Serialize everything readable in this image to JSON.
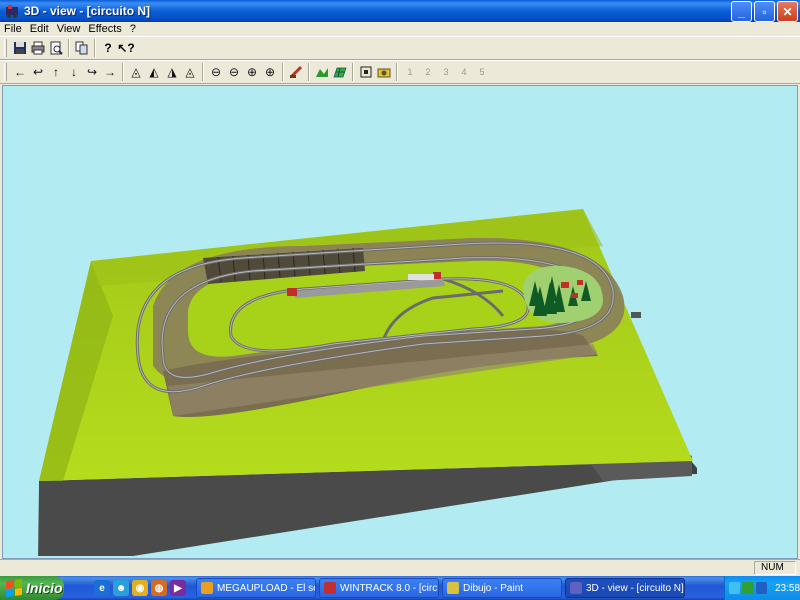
{
  "window": {
    "title": "3D - view - [circuito  N]",
    "controls": {
      "minimize": "_",
      "maximize": "▫",
      "close": "✕"
    }
  },
  "menu": [
    "File",
    "Edit",
    "View",
    "Effects",
    "?"
  ],
  "toolbar1": [
    {
      "name": "save-icon",
      "glyph": "💾"
    },
    {
      "name": "print-icon",
      "glyph": "🖨"
    },
    {
      "name": "print-preview-icon",
      "glyph": "🔍"
    },
    {
      "name": "copy-icon",
      "glyph": "📋"
    },
    {
      "name": "help-icon",
      "glyph": "?"
    },
    {
      "name": "context-help-icon",
      "glyph": "?"
    }
  ],
  "toolbar2": {
    "arrows": [
      "←",
      "↩",
      "↑",
      "↓",
      "↪",
      "→"
    ],
    "camera": [
      "◬",
      "◭",
      "◮",
      "◬"
    ],
    "zoom": [
      "⊖",
      "⊖",
      "⊕",
      "⊕"
    ],
    "tools": [
      "⚒",
      "▦",
      "▤",
      "⛶",
      "▣"
    ],
    "presets": [
      "1",
      "2",
      "3",
      "4",
      "5"
    ]
  },
  "status": {
    "num": "NUM"
  },
  "taskbar": {
    "start_label": "Inicio",
    "tasks": [
      {
        "label": "MEGAUPLOAD - El ser...",
        "color": "#e8a020"
      },
      {
        "label": "WINTRACK 8.0 - [circ...",
        "color": "#c03030"
      },
      {
        "label": "Dibujo - Paint",
        "color": "#d8c040"
      },
      {
        "label": "3D - view - [circuito  N]",
        "color": "#6060c0",
        "active": true
      }
    ],
    "clock": "23:58"
  },
  "scene": {
    "sky_color": "#b2ebf1",
    "ground_color": "#a6d41a",
    "base_color": "#4a4a4a"
  }
}
